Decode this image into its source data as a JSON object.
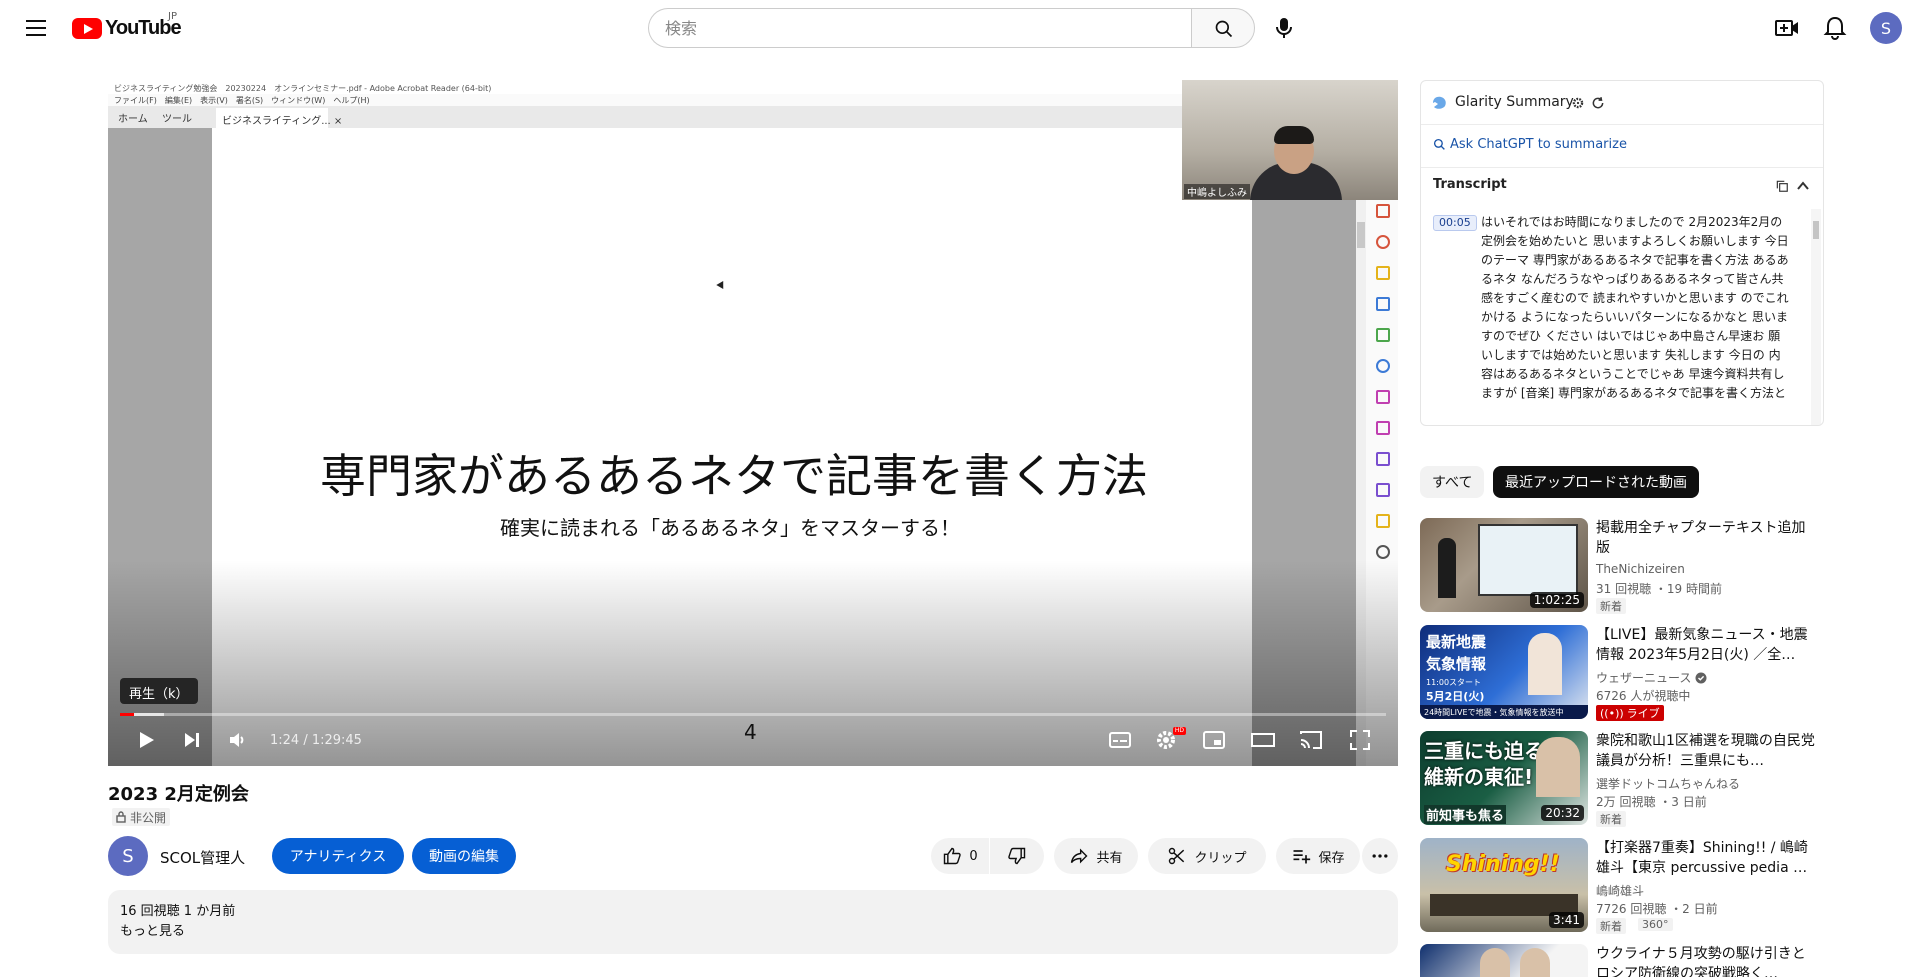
{
  "header": {
    "logo_text": "YouTube",
    "country_code": "JP",
    "search_placeholder": "検索",
    "avatar_letter": "S"
  },
  "player": {
    "pdf_window_title": "ビジネスライティング勉強会　20230224　オンラインセミナー.pdf - Adobe Acrobat Reader (64-bit)",
    "pdf_menu": "ファイル(F)　編集(E)　表示(V)　署名(S)　ウィンドウ(W)　ヘルプ(H)",
    "pdf_tab_home": "ホーム",
    "pdf_tab_tools": "ツール",
    "pdf_tab_doc": "ビジネスライティング...",
    "webcam_name": "中嶋よしふみ",
    "slide_title": "専門家があるあるネタで記事を書く方法",
    "slide_subtitle": "確実に読まれる「あるあるネタ」をマスターする！",
    "slide_page_number": "4",
    "play_tooltip": "再生（k）",
    "time_display": "1:24 / 1:29:45",
    "progress_fraction": 0.011,
    "hd_label": "HD"
  },
  "video": {
    "title": "2023 2月定例会",
    "privacy": "非公開",
    "channel_letter": "S",
    "channel_name": "SCOL管理人",
    "analytics_label": "アナリティクス",
    "edit_label": "動画の編集",
    "like_count": "0",
    "share_label": "共有",
    "clip_label": "クリップ",
    "save_label": "保存",
    "description_stats": "16 回視聴  1 か月前",
    "show_more": "もっと見る"
  },
  "glarity": {
    "title": "Glarity Summary",
    "ask_chatgpt": "Ask ChatGPT to summarize",
    "transcript_label": "Transcript",
    "timestamp": "00:05",
    "transcript_text": "はいそれではお時間になりましたので 2月2023年2月の定例会を始めたいと 思いますよろしくお願いします 今日のテーマ 専門家があるあるネタで記事を書く方法 あるあるネタ なんだろうなやっぱりあるあるネタって皆さん共感をすごく産むので 読まれやすいかと思います のでこれかける ようになったらいいパターンになるかなと 思いますのでぜひ ください はいではじゃあ中島さん早速お 願いしますでは始めたいと思います 失礼します 今日の 内容はあるあるネタということでじゃあ 早速今資料共有しますが [音楽] 専門家があるあるネタで記事を書く方法と"
  },
  "chips": {
    "all": "すべて",
    "recent": "最近アップロードされた動画"
  },
  "recommendations": [
    {
      "title": "掲載用全チャプターテキスト追加版",
      "channel": "TheNichizeiren",
      "meta": "31 回視聴 ・19 時間前",
      "badge": "新着",
      "duration": "1:02:25"
    },
    {
      "title": "【LIVE】最新気象ニュース・地震情報 2023年5月2日(火) ／全…",
      "channel": "ウェザーニュース",
      "meta": "6726 人が視聴中",
      "badge": "ライブ",
      "thumb_text_1": "最新地震",
      "thumb_text_2": "気象情報",
      "thumb_text_3": "11:00スタート",
      "thumb_text_4": "5月2日(火)",
      "thumb_text_5": "24時間LIVEで地震・気象情報を放送中"
    },
    {
      "title": "衆院和歌山1区補選を現職の自民党議員が分析！三重県にも…",
      "channel": "選挙ドットコムちゃんねる",
      "meta": "2万 回視聴 ・3 日前",
      "badge": "新着",
      "duration": "20:32",
      "thumb_text_1": "三重にも迫る?",
      "thumb_text_2": "維新の東征!",
      "thumb_text_3": "前知事も焦る"
    },
    {
      "title": "【打楽器7重奏】Shining!! / 嶋崎雄斗【東京 percussive pedia …",
      "channel": "嶋崎雄斗",
      "meta": "7726 回視聴 ・2 日前",
      "badge": "新着",
      "badge2": "360°",
      "duration": "3:41",
      "thumb_text_1": "Shining!!"
    },
    {
      "title": "ウクライナ５月攻勢の駆け引きとロシア防衛線の突破戦略く…"
    }
  ]
}
